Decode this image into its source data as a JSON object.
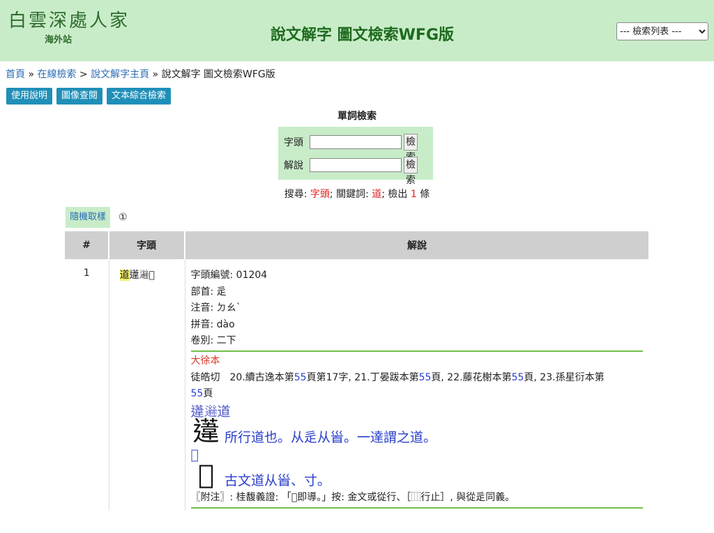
{
  "header": {
    "logo_main": "白雲深處人家",
    "logo_sub": "海外站",
    "title": "說文解字 圖文檢索WFG版",
    "search_list": "--- 檢索列表 ---"
  },
  "breadcrumb": {
    "home": "首頁",
    "sep1": " » ",
    "online": "在線檢索",
    "sep2": " > ",
    "shuowen": "說文解字主頁",
    "sep3": " » ",
    "current": "說文解字 圖文檢索WFG版"
  },
  "buttons": {
    "usage": "使用說明",
    "image": "圖像查閱",
    "text": "文本綜合檢索"
  },
  "single_search": {
    "title": "單詞檢索",
    "headword_label": "字頭",
    "explain_label": "解說",
    "search_btn": "檢索"
  },
  "result_summary": {
    "prefix": "搜尋: ",
    "field": "字頭",
    "mid": "; 關鍵詞: ",
    "keyword": "道",
    "mid2": "; 檢出 ",
    "count": "1",
    "suffix": " 條"
  },
  "random_btn": "隨機取樣",
  "page_marker": "①",
  "table": {
    "headers": [
      "#",
      "字頭",
      "解說"
    ],
    "row": {
      "num": "1",
      "head_hl": "道",
      "head_rest": "𨗨𨖾𡬺",
      "id": "字頭編號: 01204",
      "radical": "部首: 辵",
      "zhuyin": "注音: ㄉㄠˋ",
      "pinyin": "拼音: dào",
      "volume": "卷別: 二下",
      "edition": "大徐本",
      "line1_a": "徒皓切　20.續古逸本第",
      "p1": "55",
      "line1_b": "頁第17字, 21.丁晏跋本第",
      "p2": "55",
      "line1_c": "頁, 22.藤花榭本第",
      "p3": "55",
      "line1_d": "頁, 23.孫星衍本第",
      "p4": "55",
      "line1_e": "頁",
      "glyphs1": "𨗨𨖾道",
      "seal1": "𨗨",
      "explain1": "所行道也。从辵从𩠐。一達謂之道。",
      "glyph2": "𡬺",
      "seal2": "𡬺",
      "explain2": "古文道从𩠐、寸。",
      "note": "〖附注〗: 桂馥義證: 「𡬺即導。」按: 金文或從行、［⿲行止］, 與從辵同義。"
    }
  }
}
